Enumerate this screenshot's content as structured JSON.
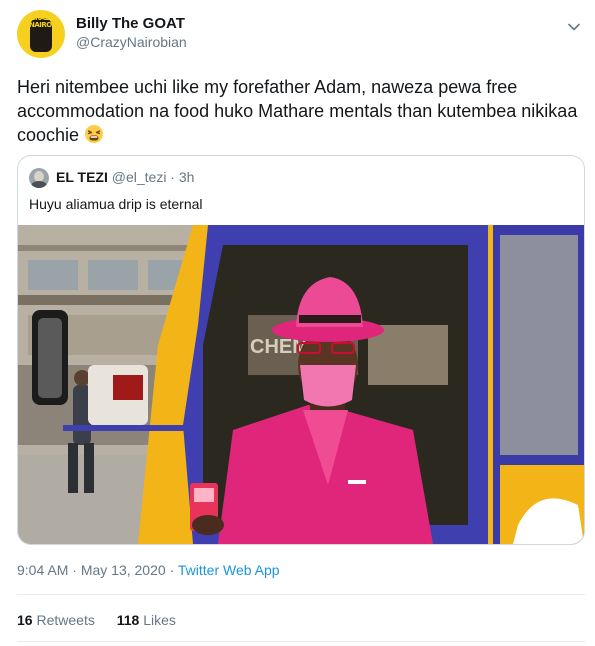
{
  "tweet": {
    "display_name": "Billy The GOAT",
    "handle": "@CrazyNairobian",
    "avatar_text": "CRAZY NAIROBIAN",
    "text": "Heri nitembee uchi like my forefather Adam, naweza pewa free accommodation na food huko Mathare mentals than kutembea nikikaa coochie",
    "emoji": "tired-face-emoji",
    "time": "9:04 AM",
    "date": "May 13, 2020",
    "separator": "·",
    "source": "Twitter Web App",
    "retweets_count": "16",
    "retweets_label": "Retweets",
    "likes_count": "118",
    "likes_label": "Likes"
  },
  "quote": {
    "display_name": "EL TEZI",
    "handle": "@el_tezi",
    "separator": "·",
    "age": "3h",
    "text": "Huyu aliamua drip is eternal",
    "image_sign_text": "CHEMI"
  },
  "colors": {
    "accent": "#1b95e0",
    "muted": "#657786",
    "pink_suit": "#e0267a",
    "bus_yellow": "#f2b416",
    "bus_blue": "#3f3fb0"
  },
  "icons": {
    "menu": "chevron-down-icon"
  }
}
